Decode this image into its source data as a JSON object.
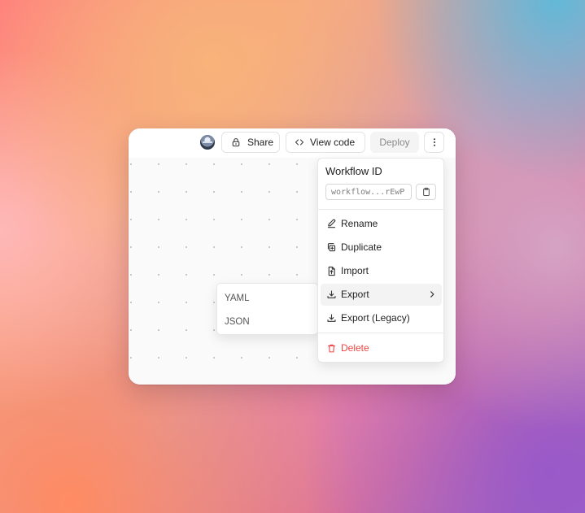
{
  "toolbar": {
    "share_label": "Share",
    "view_code_label": "View code",
    "deploy_label": "Deploy"
  },
  "workflow": {
    "title": "Workflow ID",
    "id_value": "workflow...rEwP"
  },
  "menu": {
    "items": [
      {
        "label": "Rename",
        "icon": "edit-icon"
      },
      {
        "label": "Duplicate",
        "icon": "duplicate-icon"
      },
      {
        "label": "Import",
        "icon": "import-file-icon"
      },
      {
        "label": "Export",
        "icon": "download-icon"
      },
      {
        "label": "Export (Legacy)",
        "icon": "download-icon"
      },
      {
        "label": "Delete",
        "icon": "trash-icon"
      }
    ]
  },
  "export_submenu": {
    "items": [
      {
        "label": "YAML"
      },
      {
        "label": "JSON"
      }
    ]
  },
  "colors": {
    "delete": "#ef4444",
    "disabled_text": "#8a8a8a"
  }
}
